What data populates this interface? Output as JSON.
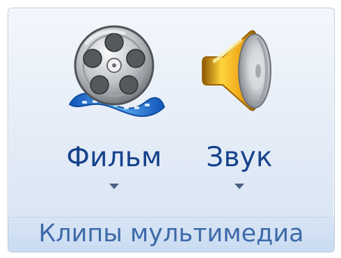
{
  "ribbon_group": {
    "caption": "Клипы мультимедиа",
    "buttons": [
      {
        "label": "Фильм",
        "icon": "film-reel-icon",
        "has_dropdown": true
      },
      {
        "label": "Звук",
        "icon": "speaker-icon",
        "has_dropdown": true
      }
    ]
  },
  "colors": {
    "label_text": "#15428b",
    "caption_text": "#3e6aaa",
    "group_background": "#dfe9f6"
  }
}
